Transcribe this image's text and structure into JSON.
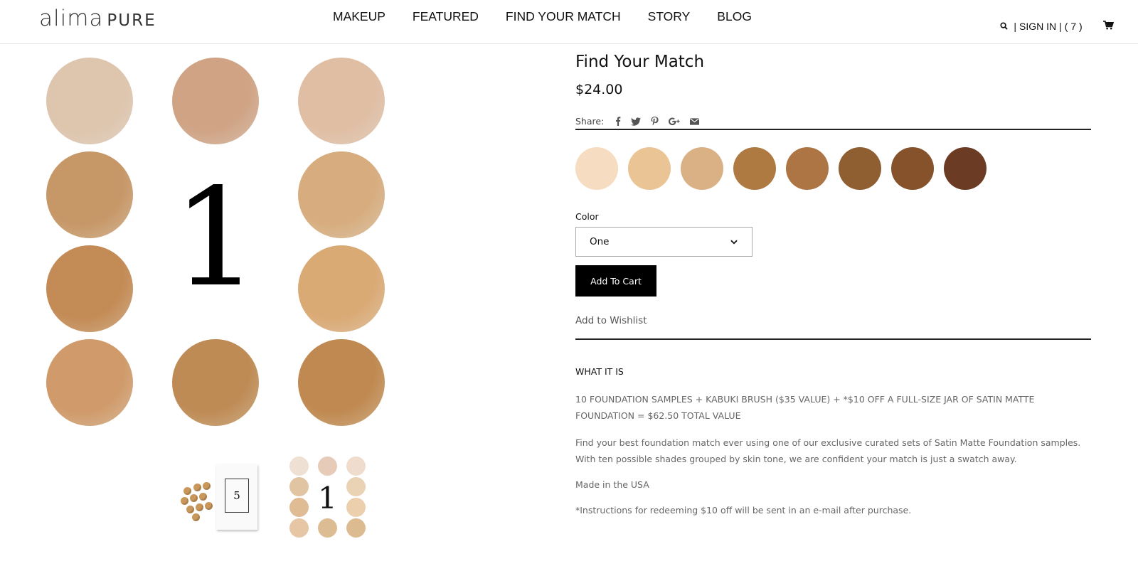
{
  "header": {
    "logo_part1": "alima",
    "logo_part2": "PURE",
    "nav": [
      "MAKEUP",
      "FEATURED",
      "FIND YOUR MATCH",
      "STORY",
      "BLOG"
    ],
    "sign_in": "SIGN IN",
    "cart_count": "( 7 )"
  },
  "gallery": {
    "numeral": "1",
    "thumb1_numeral": "5",
    "thumb2_numeral": "1",
    "swatch_colors": [
      "#eee0d2",
      "#e6ccb8",
      "#efdccc",
      "#e1c4a2",
      "#ead2b4",
      "#dfbc94",
      "#ecd0ad",
      "#e6c6a4",
      "#dcbc93",
      "#ddbb90"
    ]
  },
  "product": {
    "title": "Find Your Match",
    "price": "$24.00",
    "share_label": "Share:",
    "share_icons": [
      "facebook-icon",
      "twitter-icon",
      "pinterest-icon",
      "google-plus-icon",
      "email-icon"
    ],
    "shade_colors": [
      "#f6dcc0",
      "#ebc496",
      "#d9b185",
      "#ae7a42",
      "#ad7444",
      "#8f5e31",
      "#85522b",
      "#6b3b24"
    ],
    "color_label": "Color",
    "color_value": "One",
    "add_to_cart": "Add To Cart",
    "wishlist": "Add to Wishlist",
    "section_heading": "WHAT IT IS",
    "desc1": "10 FOUNDATION SAMPLES + KABUKI BRUSH ($35 VALUE) + *$10 OFF A FULL-SIZE JAR OF SATIN MATTE FOUNDATION = $62.50 TOTAL VALUE",
    "desc2": "Find your best foundation match ever using one of our exclusive curated sets of Satin Matte Foundation samples. With ten possible shades grouped by skin tone, we are confident your match is just a swatch away.",
    "desc3": "Made in the USA",
    "desc4": "*Instructions for redeeming $10 off will be sent in an e-mail after purchase."
  }
}
